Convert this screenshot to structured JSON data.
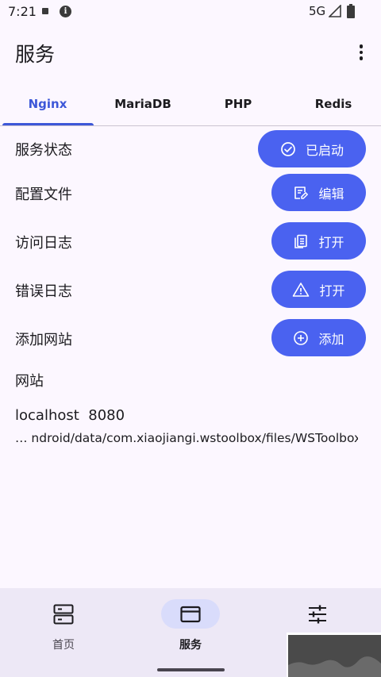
{
  "status_bar": {
    "time": "7:21",
    "network": "5G"
  },
  "app_bar": {
    "title": "服务"
  },
  "tabs": [
    {
      "label": "Nginx",
      "active": true
    },
    {
      "label": "MariaDB",
      "active": false
    },
    {
      "label": "PHP",
      "active": false
    },
    {
      "label": "Redis",
      "active": false
    }
  ],
  "rows": {
    "service_status": {
      "label": "服务状态",
      "button": "已启动",
      "icon": "check-circle-icon"
    },
    "config_file": {
      "label": "配置文件",
      "button": "编辑",
      "icon": "edit-document-icon"
    },
    "access_log": {
      "label": "访问日志",
      "button": "打开",
      "icon": "document-copy-icon"
    },
    "error_log": {
      "label": "错误日志",
      "button": "打开",
      "icon": "warning-icon"
    },
    "add_site": {
      "label": "添加网站",
      "button": "添加",
      "icon": "add-circle-icon"
    }
  },
  "sites": {
    "section_label": "网站",
    "items": [
      {
        "host": "localhost",
        "port": "8080",
        "path": "… ndroid/data/com.xiaojiangi.wstoolbox/files/WSToolbox"
      }
    ]
  },
  "bottom_nav": [
    {
      "label": "首页",
      "icon": "server-icon",
      "active": false
    },
    {
      "label": "服务",
      "icon": "window-icon",
      "active": true
    },
    {
      "label": "",
      "icon": "sliders-icon",
      "active": false
    }
  ],
  "colors": {
    "accent": "#3d57d8",
    "button": "#4a62f0",
    "background": "#fcf7ff",
    "nav_background": "#ede8f6",
    "nav_active_pill": "#d9dcfb"
  }
}
